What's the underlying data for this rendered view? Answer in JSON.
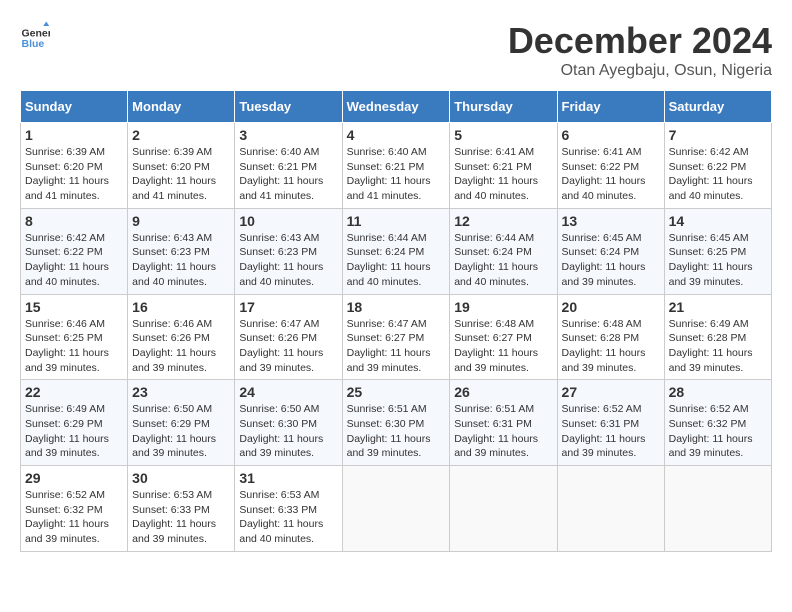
{
  "header": {
    "logo_general": "General",
    "logo_blue": "Blue",
    "month_title": "December 2024",
    "subtitle": "Otan Ayegbaju, Osun, Nigeria"
  },
  "weekdays": [
    "Sunday",
    "Monday",
    "Tuesday",
    "Wednesday",
    "Thursday",
    "Friday",
    "Saturday"
  ],
  "weeks": [
    [
      {
        "day": "1",
        "sunrise": "6:39 AM",
        "sunset": "6:20 PM",
        "daylight": "11 hours and 41 minutes."
      },
      {
        "day": "2",
        "sunrise": "6:39 AM",
        "sunset": "6:20 PM",
        "daylight": "11 hours and 41 minutes."
      },
      {
        "day": "3",
        "sunrise": "6:40 AM",
        "sunset": "6:21 PM",
        "daylight": "11 hours and 41 minutes."
      },
      {
        "day": "4",
        "sunrise": "6:40 AM",
        "sunset": "6:21 PM",
        "daylight": "11 hours and 41 minutes."
      },
      {
        "day": "5",
        "sunrise": "6:41 AM",
        "sunset": "6:21 PM",
        "daylight": "11 hours and 40 minutes."
      },
      {
        "day": "6",
        "sunrise": "6:41 AM",
        "sunset": "6:22 PM",
        "daylight": "11 hours and 40 minutes."
      },
      {
        "day": "7",
        "sunrise": "6:42 AM",
        "sunset": "6:22 PM",
        "daylight": "11 hours and 40 minutes."
      }
    ],
    [
      {
        "day": "8",
        "sunrise": "6:42 AM",
        "sunset": "6:22 PM",
        "daylight": "11 hours and 40 minutes."
      },
      {
        "day": "9",
        "sunrise": "6:43 AM",
        "sunset": "6:23 PM",
        "daylight": "11 hours and 40 minutes."
      },
      {
        "day": "10",
        "sunrise": "6:43 AM",
        "sunset": "6:23 PM",
        "daylight": "11 hours and 40 minutes."
      },
      {
        "day": "11",
        "sunrise": "6:44 AM",
        "sunset": "6:24 PM",
        "daylight": "11 hours and 40 minutes."
      },
      {
        "day": "12",
        "sunrise": "6:44 AM",
        "sunset": "6:24 PM",
        "daylight": "11 hours and 40 minutes."
      },
      {
        "day": "13",
        "sunrise": "6:45 AM",
        "sunset": "6:24 PM",
        "daylight": "11 hours and 39 minutes."
      },
      {
        "day": "14",
        "sunrise": "6:45 AM",
        "sunset": "6:25 PM",
        "daylight": "11 hours and 39 minutes."
      }
    ],
    [
      {
        "day": "15",
        "sunrise": "6:46 AM",
        "sunset": "6:25 PM",
        "daylight": "11 hours and 39 minutes."
      },
      {
        "day": "16",
        "sunrise": "6:46 AM",
        "sunset": "6:26 PM",
        "daylight": "11 hours and 39 minutes."
      },
      {
        "day": "17",
        "sunrise": "6:47 AM",
        "sunset": "6:26 PM",
        "daylight": "11 hours and 39 minutes."
      },
      {
        "day": "18",
        "sunrise": "6:47 AM",
        "sunset": "6:27 PM",
        "daylight": "11 hours and 39 minutes."
      },
      {
        "day": "19",
        "sunrise": "6:48 AM",
        "sunset": "6:27 PM",
        "daylight": "11 hours and 39 minutes."
      },
      {
        "day": "20",
        "sunrise": "6:48 AM",
        "sunset": "6:28 PM",
        "daylight": "11 hours and 39 minutes."
      },
      {
        "day": "21",
        "sunrise": "6:49 AM",
        "sunset": "6:28 PM",
        "daylight": "11 hours and 39 minutes."
      }
    ],
    [
      {
        "day": "22",
        "sunrise": "6:49 AM",
        "sunset": "6:29 PM",
        "daylight": "11 hours and 39 minutes."
      },
      {
        "day": "23",
        "sunrise": "6:50 AM",
        "sunset": "6:29 PM",
        "daylight": "11 hours and 39 minutes."
      },
      {
        "day": "24",
        "sunrise": "6:50 AM",
        "sunset": "6:30 PM",
        "daylight": "11 hours and 39 minutes."
      },
      {
        "day": "25",
        "sunrise": "6:51 AM",
        "sunset": "6:30 PM",
        "daylight": "11 hours and 39 minutes."
      },
      {
        "day": "26",
        "sunrise": "6:51 AM",
        "sunset": "6:31 PM",
        "daylight": "11 hours and 39 minutes."
      },
      {
        "day": "27",
        "sunrise": "6:52 AM",
        "sunset": "6:31 PM",
        "daylight": "11 hours and 39 minutes."
      },
      {
        "day": "28",
        "sunrise": "6:52 AM",
        "sunset": "6:32 PM",
        "daylight": "11 hours and 39 minutes."
      }
    ],
    [
      {
        "day": "29",
        "sunrise": "6:52 AM",
        "sunset": "6:32 PM",
        "daylight": "11 hours and 39 minutes."
      },
      {
        "day": "30",
        "sunrise": "6:53 AM",
        "sunset": "6:33 PM",
        "daylight": "11 hours and 39 minutes."
      },
      {
        "day": "31",
        "sunrise": "6:53 AM",
        "sunset": "6:33 PM",
        "daylight": "11 hours and 40 minutes."
      },
      null,
      null,
      null,
      null
    ]
  ],
  "labels": {
    "sunrise": "Sunrise:",
    "sunset": "Sunset:",
    "daylight": "Daylight:"
  }
}
